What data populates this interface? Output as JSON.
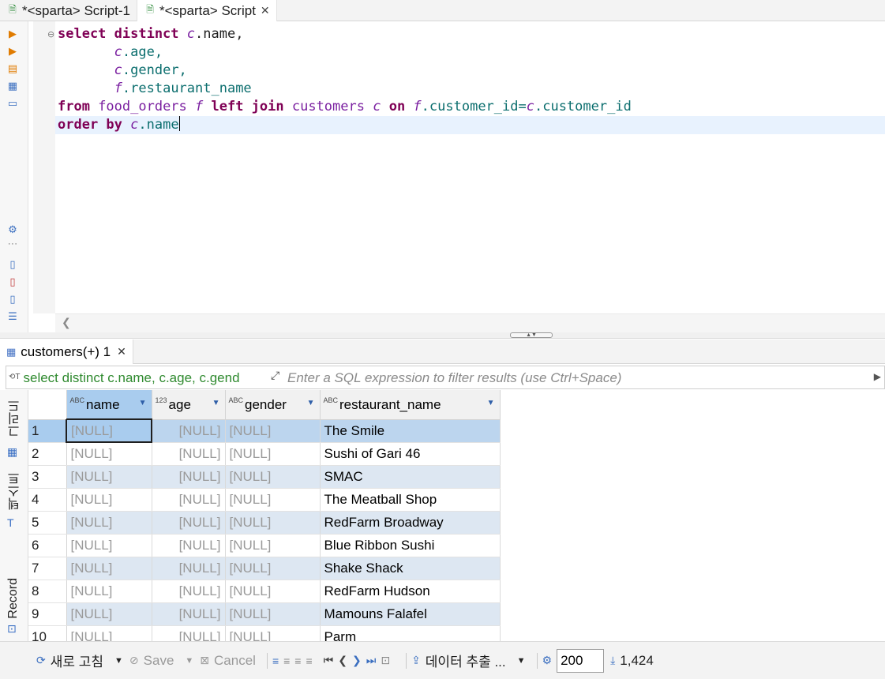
{
  "tabs": [
    {
      "label": "*<sparta> Script-1",
      "active": false
    },
    {
      "label": "*<sparta> Script",
      "active": true
    }
  ],
  "editor": {
    "lines": [
      [
        "select distinct ",
        "c",
        ".name,"
      ],
      [
        "c",
        ".age,"
      ],
      [
        "c",
        ".gender,"
      ],
      [
        "f",
        ".restaurant_name"
      ],
      [
        "from ",
        "food_orders",
        " f ",
        "left join ",
        "customers",
        " c ",
        "on ",
        "f",
        ".customer_id=",
        "c",
        ".customer_id"
      ],
      [
        "order by ",
        "c",
        ".name"
      ]
    ]
  },
  "results_tab": {
    "label": "customers(+) 1"
  },
  "filter": {
    "sql_snippet": "select distinct c.name, c.age, c.gend",
    "placeholder": "Enter a SQL expression to filter results (use Ctrl+Space)"
  },
  "side_tabs": {
    "grid": "그리드",
    "text": "텍스트",
    "record": "Record"
  },
  "columns": [
    {
      "name": "name",
      "type": "ABC"
    },
    {
      "name": "age",
      "type": "123"
    },
    {
      "name": "gender",
      "type": "ABC"
    },
    {
      "name": "restaurant_name",
      "type": "ABC"
    }
  ],
  "rows": [
    [
      "1",
      "[NULL]",
      "[NULL]",
      "[NULL]",
      "The Smile"
    ],
    [
      "2",
      "[NULL]",
      "[NULL]",
      "[NULL]",
      "Sushi of Gari 46"
    ],
    [
      "3",
      "[NULL]",
      "[NULL]",
      "[NULL]",
      "SMAC"
    ],
    [
      "4",
      "[NULL]",
      "[NULL]",
      "[NULL]",
      "The Meatball Shop"
    ],
    [
      "5",
      "[NULL]",
      "[NULL]",
      "[NULL]",
      "RedFarm Broadway"
    ],
    [
      "6",
      "[NULL]",
      "[NULL]",
      "[NULL]",
      "Blue Ribbon Sushi"
    ],
    [
      "7",
      "[NULL]",
      "[NULL]",
      "[NULL]",
      "Shake Shack"
    ],
    [
      "8",
      "[NULL]",
      "[NULL]",
      "[NULL]",
      "RedFarm Hudson"
    ],
    [
      "9",
      "[NULL]",
      "[NULL]",
      "[NULL]",
      "Mamouns Falafel"
    ],
    [
      "10",
      "[NULL]",
      "[NULL]",
      "[NULL]",
      "Parm"
    ]
  ],
  "toolbar": {
    "refresh": "새로 고침",
    "save": "Save",
    "cancel": "Cancel",
    "export": "데이터 추출 ...",
    "fetch_size": "200",
    "row_count": "1,424"
  }
}
